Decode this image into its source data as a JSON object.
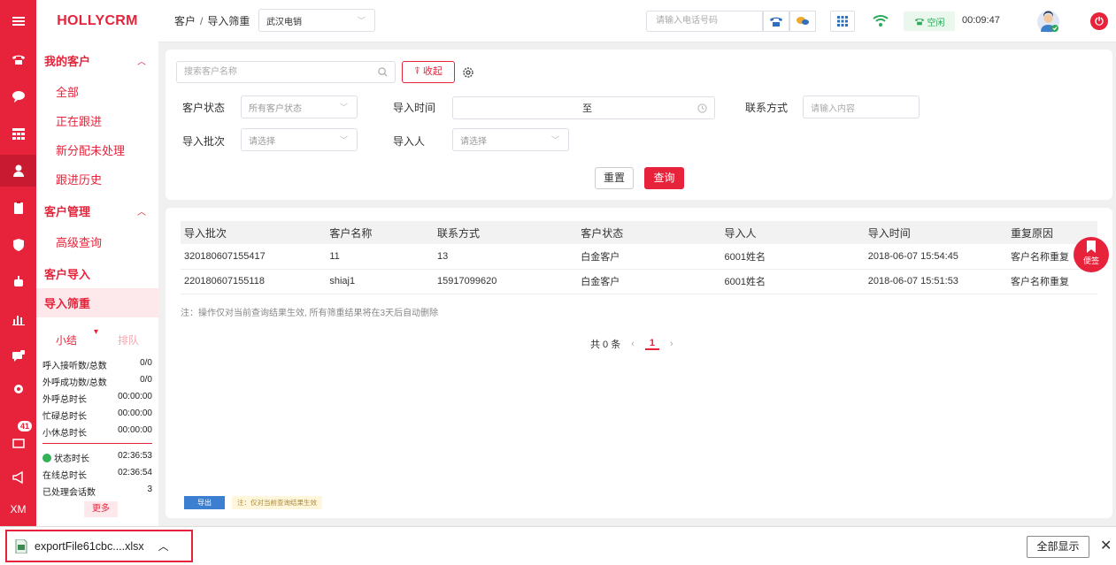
{
  "app": {
    "logo": "HOLLYCRM"
  },
  "rail": {
    "badge_count": "41",
    "xm_label": "XM"
  },
  "sidebar": {
    "group1": {
      "title": "我的客户",
      "items": [
        "全部",
        "正在跟进",
        "新分配未处理",
        "跟进历史"
      ]
    },
    "group2": {
      "title": "客户管理",
      "items": [
        "高级查询"
      ]
    },
    "group3": {
      "title": "客户导入",
      "active_item": "导入筛重"
    },
    "stats": {
      "tab_summary": "小结",
      "tab_queue": "排队",
      "rows": [
        {
          "label": "呼入接听数/总数",
          "value": "0/0"
        },
        {
          "label": "外呼成功数/总数",
          "value": "0/0"
        },
        {
          "label": "外呼总时长",
          "value": "00:00:00"
        },
        {
          "label": "忙碌总时长",
          "value": "00:00:00"
        },
        {
          "label": "小休总时长",
          "value": "00:00:00"
        }
      ],
      "rows2": [
        {
          "label": "状态时长",
          "value": "02:36:53"
        },
        {
          "label": "在线总时长",
          "value": "02:36:54"
        },
        {
          "label": "已处理会话数",
          "value": "3"
        }
      ],
      "more": "更多"
    }
  },
  "topbar": {
    "breadcrumb_root": "客户",
    "breadcrumb_sep": "/",
    "breadcrumb_current": "导入筛重",
    "org_select": "武汉电销",
    "phone_placeholder": "请输入电话号码",
    "status": "空闲",
    "timer": "00:09:47"
  },
  "filters": {
    "search_placeholder": "搜索客户名称",
    "fold_label": "收起",
    "customer_status_label": "客户状态",
    "customer_status_value": "所有客户状态",
    "import_time_label": "导入时间",
    "import_time_to": "至",
    "contact_label": "联系方式",
    "contact_placeholder": "请输入内容",
    "batch_label": "导入批次",
    "batch_placeholder": "请选择",
    "importer_label": "导入人",
    "importer_placeholder": "请选择",
    "reset": "重置",
    "query": "查询"
  },
  "table": {
    "headers": [
      "导入批次",
      "客户名称",
      "联系方式",
      "客户状态",
      "导入人",
      "导入时间",
      "重复原因"
    ],
    "rows": [
      [
        "320180607155417",
        "11",
        "13",
        "白金客户",
        "6001姓名",
        "2018-06-07 15:54:45",
        "客户名称重复"
      ],
      [
        "220180607155118",
        "shiaj1",
        "15917099620",
        "白金客户",
        "6001姓名",
        "2018-06-07 15:51:53",
        "客户名称重复"
      ]
    ],
    "note": "注：操作仅对当前查询结果生效, 所有筛重结果将在3天后自动删除",
    "pager_total": "共 0 条",
    "pager_current": "1",
    "export": "导出",
    "export_note": "注：仅对当前查询结果生效"
  },
  "bookmark": {
    "label": "便签"
  },
  "download": {
    "file": "exportFile61cbc....xlsx",
    "show_all": "全部显示"
  }
}
